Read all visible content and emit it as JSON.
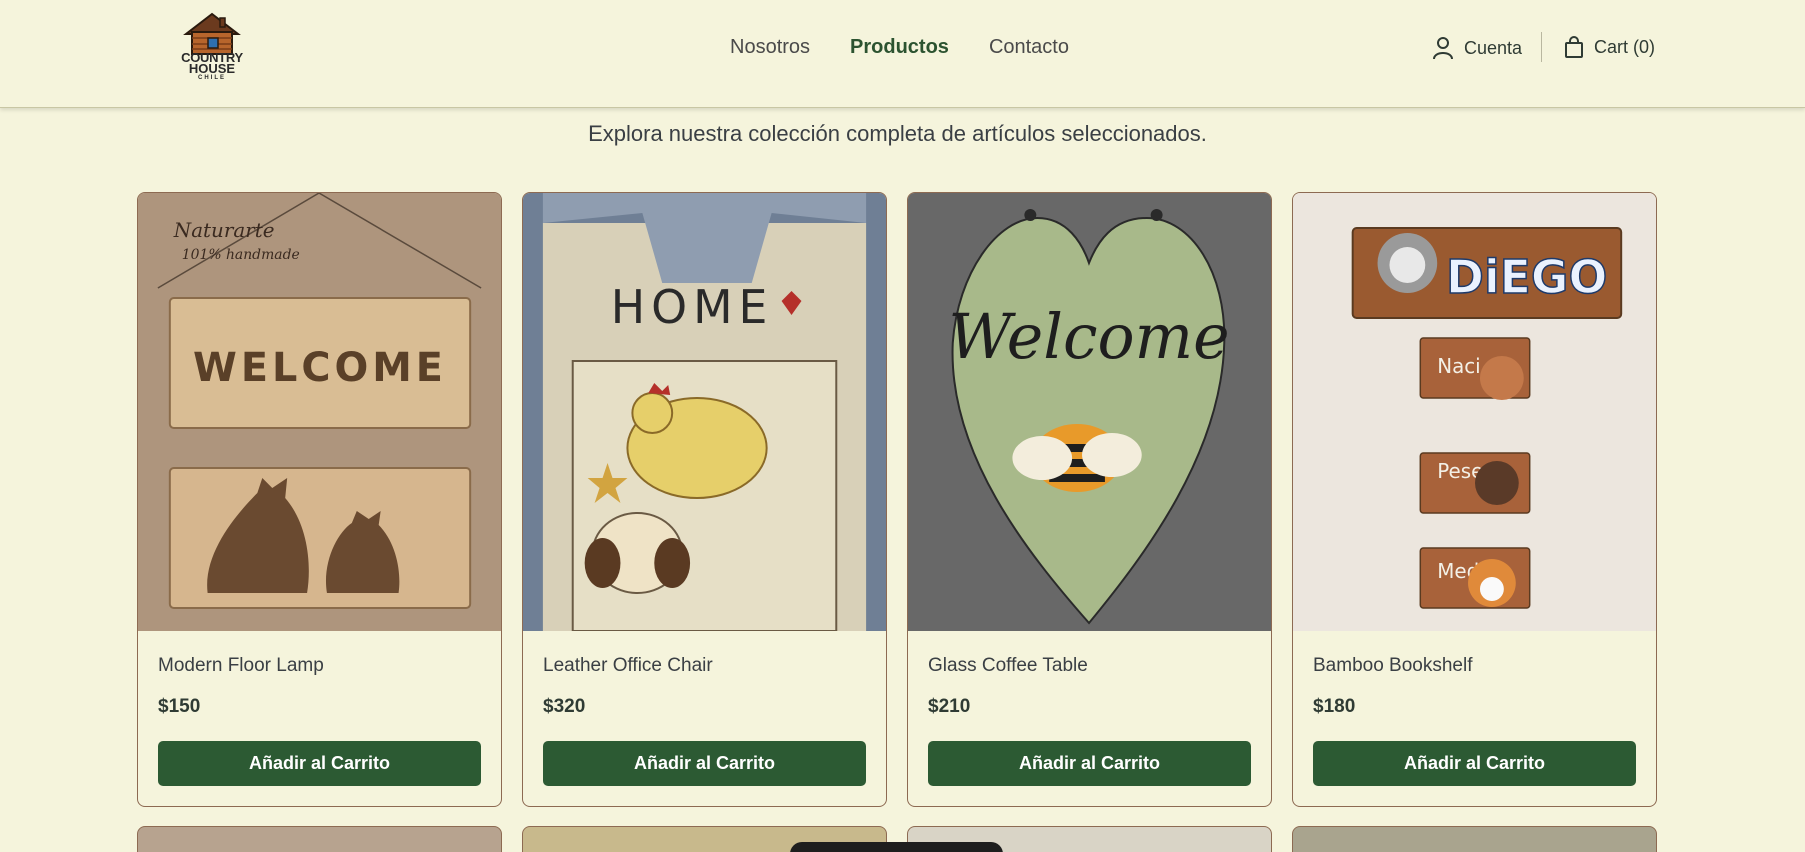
{
  "brand": {
    "line1": "COUNTRY",
    "line2": "HOUSE",
    "line3": "CHILE"
  },
  "nav": [
    {
      "label": "Nosotros"
    },
    {
      "label": "Productos"
    },
    {
      "label": "Contacto"
    }
  ],
  "account": {
    "label": "Cuenta"
  },
  "cart": {
    "label": "Cart (0)"
  },
  "intro": "Explora nuestra colección completa de artículos seleccionados.",
  "products": [
    {
      "name": "Modern Floor Lamp",
      "price": "$150",
      "button": "Añadir al Carrito"
    },
    {
      "name": "Leather Office Chair",
      "price": "$320",
      "button": "Añadir al Carrito"
    },
    {
      "name": "Glass Coffee Table",
      "price": "$210",
      "button": "Añadir al Carrito"
    },
    {
      "name": "Bamboo Bookshelf",
      "price": "$180",
      "button": "Añadir al Carrito"
    }
  ],
  "product_images": [
    {
      "sign_text1": "Naturarte",
      "sign_text2": "101% handmade",
      "sign_text3": "WELCOME"
    },
    {
      "sign_text1": "HOME"
    },
    {
      "sign_text1": "Welcome"
    },
    {
      "sign_text1": "DiEGO",
      "sign_text2": "Naci",
      "sign_text3": "Pese",
      "sign_text4": "Medi"
    }
  ],
  "colors": {
    "background": "#f5f4dc",
    "accent": "#2c5a33",
    "card_border": "#8d6a52"
  }
}
